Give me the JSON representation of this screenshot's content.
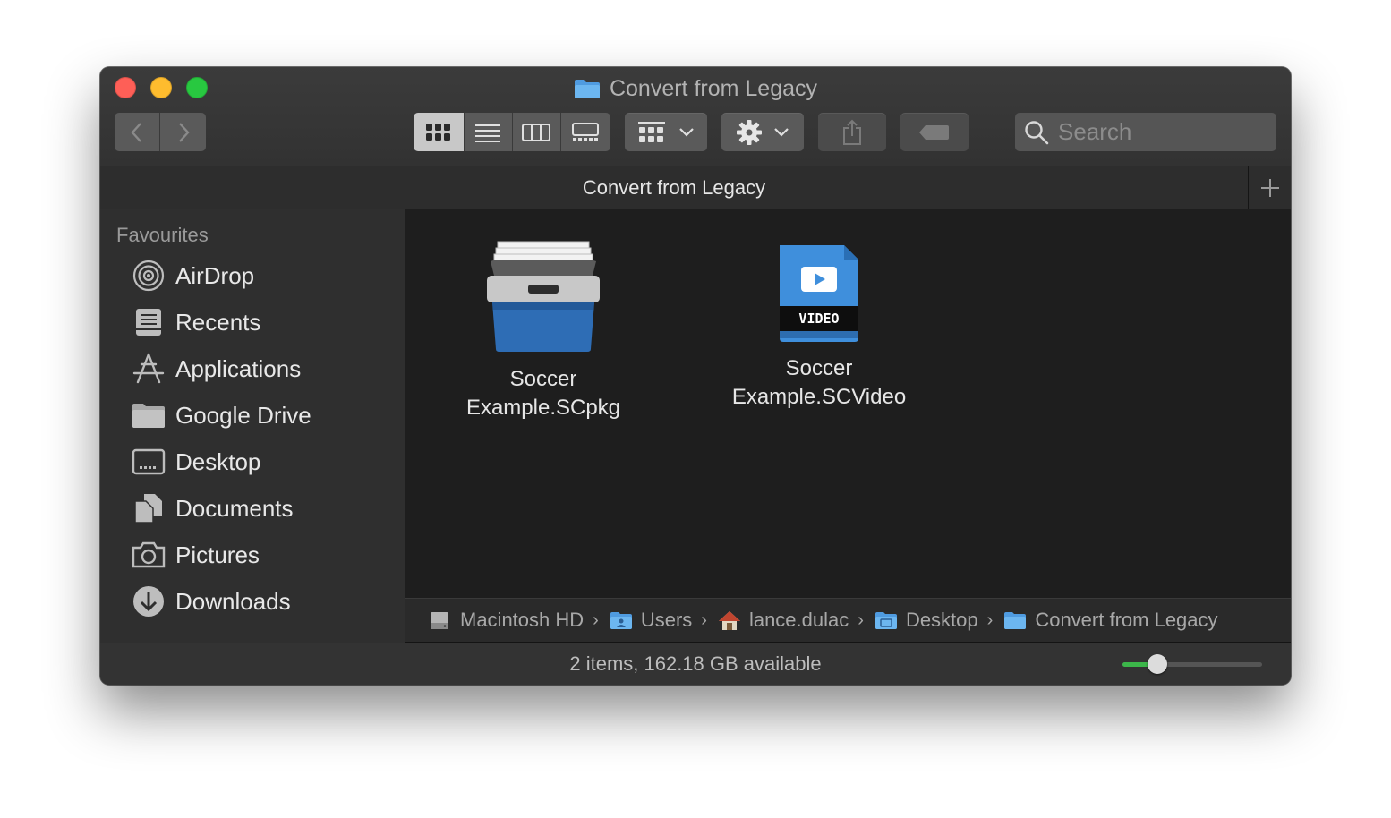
{
  "window": {
    "title": "Convert from Legacy"
  },
  "toolbar": {
    "search_placeholder": "Search"
  },
  "tab": {
    "title": "Convert from Legacy"
  },
  "sidebar": {
    "heading": "Favourites",
    "items": [
      {
        "label": "AirDrop",
        "icon": "airdrop-icon"
      },
      {
        "label": "Recents",
        "icon": "recents-icon"
      },
      {
        "label": "Applications",
        "icon": "applications-icon"
      },
      {
        "label": "Google Drive",
        "icon": "folder-icon"
      },
      {
        "label": "Desktop",
        "icon": "desktop-icon"
      },
      {
        "label": "Documents",
        "icon": "documents-icon"
      },
      {
        "label": "Pictures",
        "icon": "camera-icon"
      },
      {
        "label": "Downloads",
        "icon": "download-icon"
      }
    ]
  },
  "files": [
    {
      "line1": "Soccer",
      "line2": "Example.SCpkg",
      "icon": "package-icon"
    },
    {
      "line1": "Soccer",
      "line2": "Example.SCVideo",
      "icon": "video-file-icon",
      "badge": "VIDEO"
    }
  ],
  "pathbar": {
    "crumbs": [
      {
        "label": "Macintosh HD",
        "icon": "hard-drive-icon"
      },
      {
        "label": "Users",
        "icon": "users-folder-icon"
      },
      {
        "label": "lance.dulac",
        "icon": "home-icon"
      },
      {
        "label": "Desktop",
        "icon": "desktop-folder-icon"
      },
      {
        "label": "Convert from Legacy",
        "icon": "folder-icon"
      }
    ]
  },
  "status": {
    "text": "2 items, 162.18 GB available",
    "icon_size_level": 0.25
  },
  "colors": {
    "accent_green": "#3cb64a",
    "folder_blue": "#5aa9e6"
  }
}
